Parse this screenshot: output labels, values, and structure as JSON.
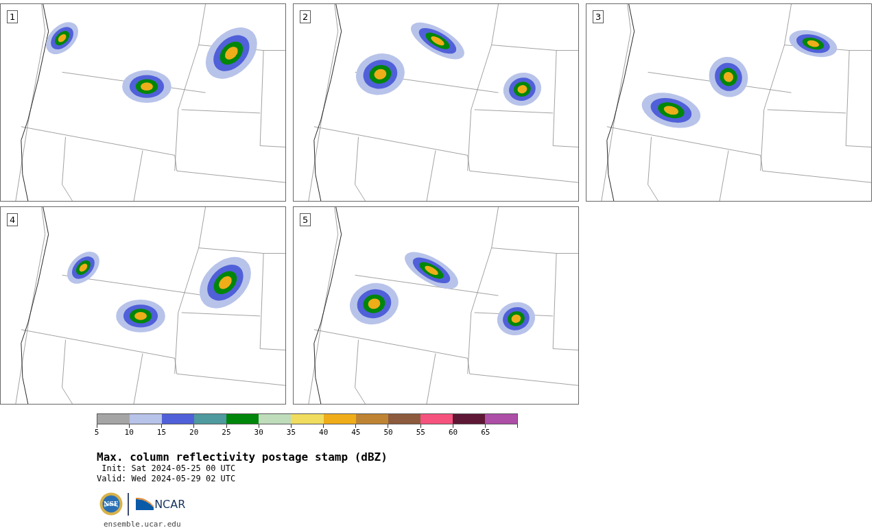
{
  "panels": [
    {
      "label": "1"
    },
    {
      "label": "2"
    },
    {
      "label": "3"
    },
    {
      "label": "4"
    },
    {
      "label": "5"
    }
  ],
  "colorbar": {
    "segments": [
      {
        "color": "#a5a5a5",
        "tick": "5"
      },
      {
        "color": "#b8c3ea",
        "tick": "10"
      },
      {
        "color": "#5060d8",
        "tick": "15"
      },
      {
        "color": "#4e9a9e",
        "tick": "20"
      },
      {
        "color": "#00860a",
        "tick": "25"
      },
      {
        "color": "#bfdcbb",
        "tick": "30"
      },
      {
        "color": "#f0dc5e",
        "tick": "35"
      },
      {
        "color": "#efad1a",
        "tick": "40"
      },
      {
        "color": "#bf8433",
        "tick": "45"
      },
      {
        "color": "#8c5a3c",
        "tick": "50"
      },
      {
        "color": "#f5527e",
        "tick": "55"
      },
      {
        "color": "#5e1735",
        "tick": "60"
      },
      {
        "color": "#ad4ea7",
        "tick": "65"
      }
    ]
  },
  "title": "Max. column reflectivity postage stamp (dBZ)",
  "init": "Init: Sat 2024-05-25 00 UTC",
  "valid": "Valid: Wed 2024-05-29 02 UTC",
  "logos": {
    "nsf": "NSF",
    "ncar": "NCAR"
  },
  "site": "ensemble.ucar.edu"
}
